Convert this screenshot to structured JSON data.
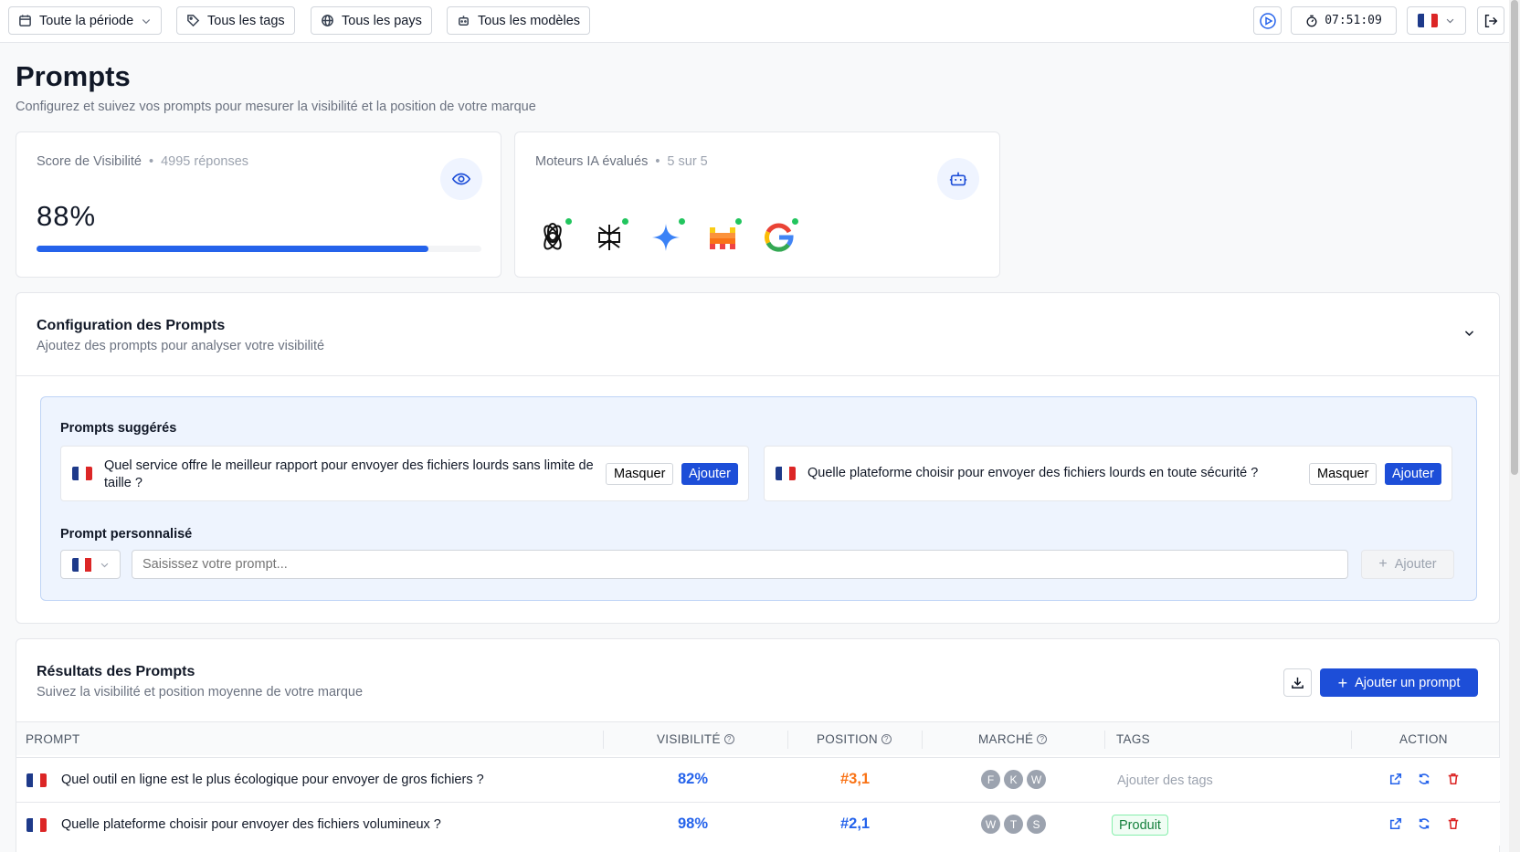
{
  "topbar": {
    "period": "Toute la période",
    "tags": "Tous les tags",
    "countries": "Tous les pays",
    "models": "Tous les modèles",
    "timer": "07:51:09"
  },
  "page": {
    "title": "Prompts",
    "subtitle": "Configurez et suivez vos prompts pour mesurer la visibilité et la position de votre marque"
  },
  "visibility_card": {
    "label": "Score de Visibilité",
    "responses": "4995 réponses",
    "value": "88%",
    "progress_percent": 88,
    "accent": "#2563eb"
  },
  "engines_card": {
    "label": "Moteurs IA évalués",
    "count": "5 sur 5",
    "engines": [
      "openai-icon",
      "perplexity-icon",
      "gemini-icon",
      "mistral-icon",
      "google-icon"
    ]
  },
  "config": {
    "title": "Configuration des Prompts",
    "subtitle": "Ajoutez des prompts pour analyser votre visibilité",
    "suggested_title": "Prompts suggérés",
    "suggestions": [
      {
        "text": "Quel service offre le meilleur rapport pour envoyer des fichiers lourds sans limite de taille ?",
        "hide": "Masquer",
        "add": "Ajouter"
      },
      {
        "text": "Quelle plateforme choisir pour envoyer des fichiers lourds en toute sécurité ?",
        "hide": "Masquer",
        "add": "Ajouter"
      }
    ],
    "custom_title": "Prompt personnalisé",
    "custom_placeholder": "Saisissez votre prompt...",
    "custom_add": "Ajouter"
  },
  "results": {
    "title": "Résultats des Prompts",
    "subtitle": "Suivez la visibilité et position moyenne de votre marque",
    "add_button": "Ajouter un prompt",
    "columns": {
      "prompt": "PROMPT",
      "visibility": "VISIBILITÉ",
      "position": "POSITION",
      "market": "MARCHÉ",
      "tags": "TAGS",
      "action": "ACTION"
    },
    "rows": [
      {
        "prompt": "Quel outil en ligne est le plus écologique pour envoyer de gros fichiers ?",
        "visibility": "82%",
        "position": "#3,1",
        "position_color": "#f97316",
        "market": [
          "F",
          "K",
          "W"
        ],
        "tags": "Ajouter des tags"
      },
      {
        "prompt": "Quelle plateforme choisir pour envoyer des fichiers volumineux ?",
        "visibility": "98%",
        "position": "#2,1",
        "position_color": "#2563eb",
        "market": [
          "W",
          "T",
          "S"
        ],
        "tags": "Produit"
      }
    ]
  }
}
